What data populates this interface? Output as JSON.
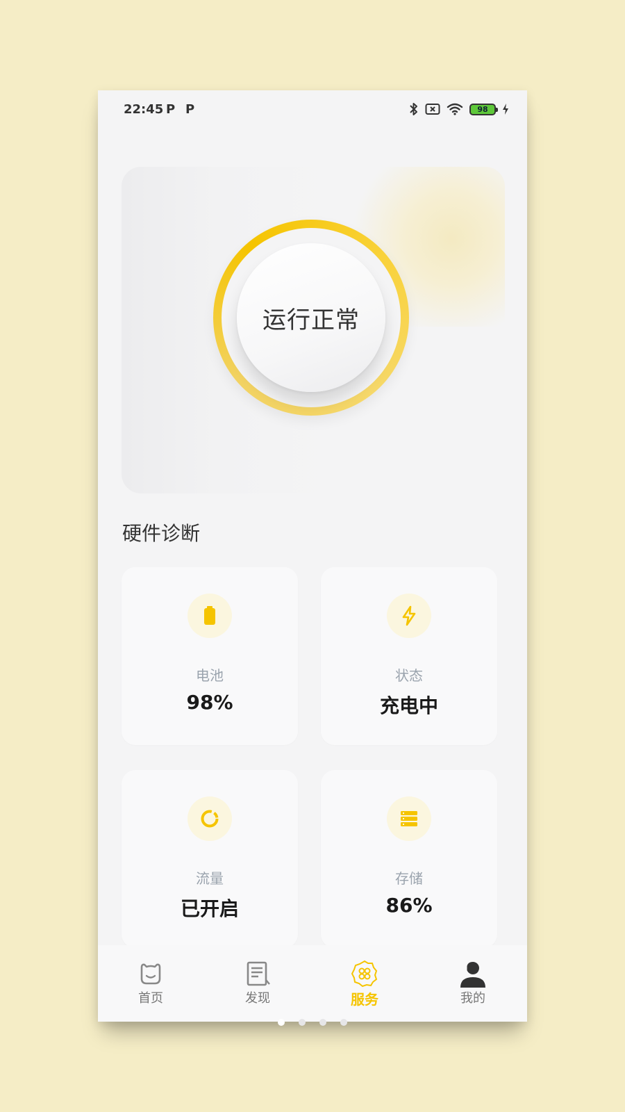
{
  "status_bar": {
    "time": "22:45",
    "notification_icons": [
      "P",
      "P"
    ],
    "battery_level": "98",
    "icons": [
      "bluetooth-icon",
      "sim-none-icon",
      "wifi-icon",
      "battery-icon",
      "charging-icon"
    ]
  },
  "hero": {
    "status_text": "运行正常",
    "accent_color": "#f5c400"
  },
  "section": {
    "title": "硬件诊断"
  },
  "cards": [
    {
      "icon": "battery-icon",
      "label": "电池",
      "value": "98%"
    },
    {
      "icon": "lightning-icon",
      "label": "状态",
      "value": "充电中"
    },
    {
      "icon": "donut-icon",
      "label": "流量",
      "value": "已开启"
    },
    {
      "icon": "storage-icon",
      "label": "存储",
      "value": "86%"
    }
  ],
  "bottom_nav": [
    {
      "icon": "home-icon",
      "label": "首页",
      "active": false
    },
    {
      "icon": "discover-icon",
      "label": "发现",
      "active": false
    },
    {
      "icon": "service-icon",
      "label": "服务",
      "active": true
    },
    {
      "icon": "profile-icon",
      "label": "我的",
      "active": false
    }
  ],
  "page_indicator": {
    "count": 4,
    "active_index": 0
  }
}
